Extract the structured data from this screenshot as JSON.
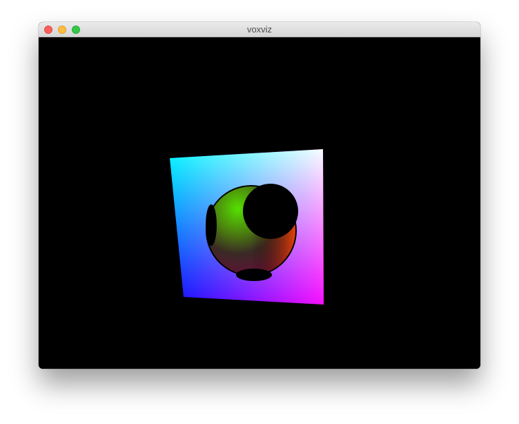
{
  "window": {
    "title": "voxviz"
  },
  "icons": {
    "close": "close-traffic-light-icon",
    "minimize": "minimize-traffic-light-icon",
    "zoom": "zoom-traffic-light-icon"
  },
  "colors": {
    "background": "#000000",
    "corner_top_left": "#00ffff",
    "corner_top_right": "#ffffff",
    "corner_bottom_left": "#0000ff",
    "corner_bottom_right": "#ff00ff",
    "sphere_top": "#44dd00",
    "sphere_right": "#ff4400",
    "sphere_dark": "#2a1420"
  },
  "scene": {
    "description_objects": [
      "rgb-cube-face",
      "hollow-sphere"
    ]
  }
}
